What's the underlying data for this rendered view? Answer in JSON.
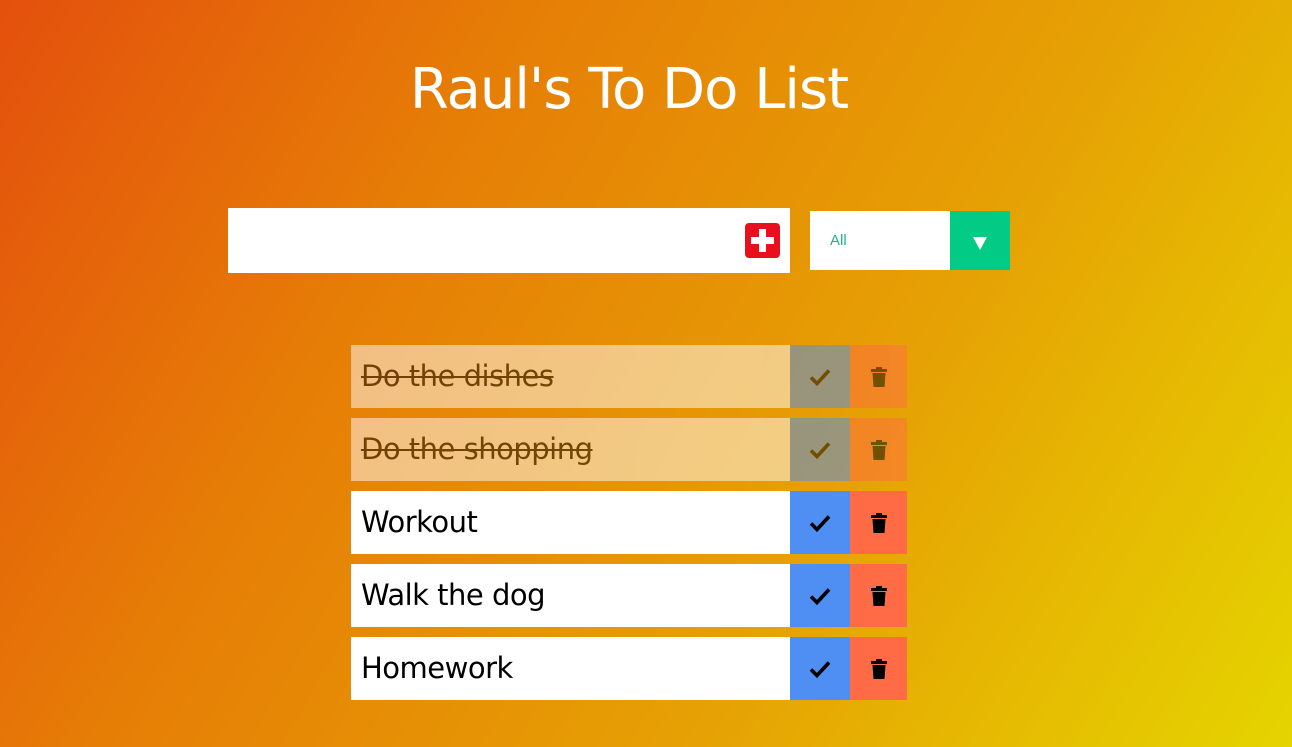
{
  "header": {
    "title": "Raul's To Do List"
  },
  "form": {
    "input_value": "",
    "input_placeholder": "",
    "add_icon": "plus-square-icon",
    "filter": {
      "selected": "All",
      "arrow_icon": "caret-down-icon"
    }
  },
  "todos": [
    {
      "text": "Do the dishes",
      "completed": true
    },
    {
      "text": "Do the shopping",
      "completed": true
    },
    {
      "text": "Workout",
      "completed": false
    },
    {
      "text": "Walk the dog",
      "completed": false
    },
    {
      "text": "Homework",
      "completed": false
    }
  ],
  "icons": {
    "complete": "check-icon",
    "trash": "trash-icon"
  },
  "colors": {
    "add_button": "#e8101c",
    "filter_accent": "#02cb86",
    "complete_button": "#4f8ef3",
    "trash_button": "#ff6b45"
  }
}
